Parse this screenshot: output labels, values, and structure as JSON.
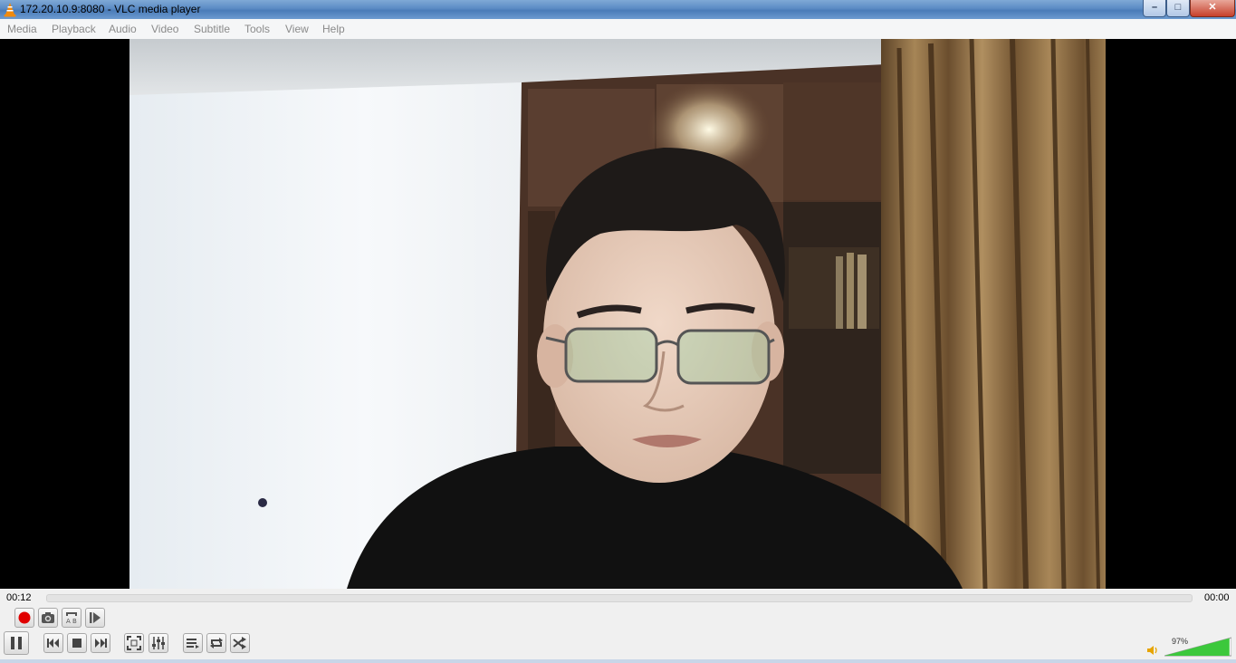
{
  "window": {
    "title": "172.20.10.9:8080 - VLC media player",
    "min_label": "–",
    "max_label": "□",
    "close_label": "✕"
  },
  "menu": [
    "Media",
    "Playback",
    "Audio",
    "Video",
    "Subtitle",
    "Tools",
    "View",
    "Help"
  ],
  "player": {
    "elapsed": "00:12",
    "remaining": "00:00",
    "position_fraction": 0,
    "volume_label": "97%",
    "volume_fraction": 0.97
  },
  "controls": {
    "row1": [
      "record-icon",
      "snapshot-icon",
      "loop-ab-icon",
      "frame-by-frame-icon"
    ],
    "row2": [
      "pause-icon",
      "previous-icon",
      "stop-icon",
      "next-icon",
      "fullscreen-icon",
      "extended-settings-icon",
      "playlist-icon",
      "loop-icon",
      "random-icon"
    ]
  },
  "colors": {
    "record": "#e00000",
    "volume_fill": "#3cc83c",
    "titlebar": "#5b8bc4"
  }
}
